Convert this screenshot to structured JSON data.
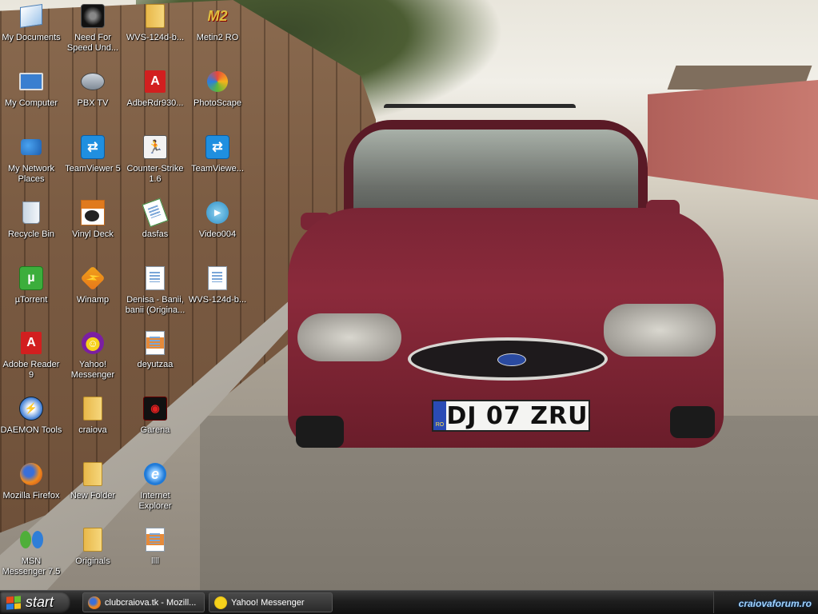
{
  "desktop": {
    "icons": [
      {
        "label": "My Documents",
        "icon": "my-documents-icon"
      },
      {
        "label": "My Computer",
        "icon": "my-computer-icon"
      },
      {
        "label": "My Network Places",
        "icon": "network-places-icon"
      },
      {
        "label": "Recycle Bin",
        "icon": "recycle-bin-icon"
      },
      {
        "label": "µTorrent",
        "icon": "utorrent-icon"
      },
      {
        "label": "Adobe Reader 9",
        "icon": "adobe-reader-icon"
      },
      {
        "label": "DAEMON Tools",
        "icon": "daemon-tools-icon"
      },
      {
        "label": "Mozilla Firefox",
        "icon": "firefox-icon"
      },
      {
        "label": "MSN Messenger 7.5",
        "icon": "msn-messenger-icon"
      },
      {
        "label": "Need For Speed Und...",
        "icon": "nfs-icon"
      },
      {
        "label": "PBX TV",
        "icon": "pbx-tv-icon"
      },
      {
        "label": "TeamViewer 5",
        "icon": "teamviewer-icon"
      },
      {
        "label": "Vinyl Deck",
        "icon": "vinyl-deck-icon"
      },
      {
        "label": "Winamp",
        "icon": "winamp-icon"
      },
      {
        "label": "Yahoo! Messenger",
        "icon": "yahoo-messenger-icon"
      },
      {
        "label": "craiova",
        "icon": "folder-icon"
      },
      {
        "label": "New Folder",
        "icon": "folder-icon"
      },
      {
        "label": "Originals",
        "icon": "folder-icon"
      },
      {
        "label": "WVS-124d-b...",
        "icon": "folder-icon"
      },
      {
        "label": "AdbeRdr930...",
        "icon": "pdf-installer-icon"
      },
      {
        "label": "Counter-Strike 1.6",
        "icon": "counter-strike-icon"
      },
      {
        "label": "dasfas",
        "icon": "document-icon"
      },
      {
        "label": "Denisa - Banii, banii (Origina...",
        "icon": "audio-file-icon"
      },
      {
        "label": "deyutzaa",
        "icon": "image-file-icon"
      },
      {
        "label": "Garena",
        "icon": "garena-icon"
      },
      {
        "label": "Internet Explorer",
        "icon": "internet-explorer-icon"
      },
      {
        "label": "llll",
        "icon": "image-file-icon"
      },
      {
        "label": "Metin2 RO",
        "icon": "metin2-icon"
      },
      {
        "label": "PhotoScape",
        "icon": "photoscape-icon"
      },
      {
        "label": "TeamViewe...",
        "icon": "teamviewer-icon"
      },
      {
        "label": "Video004",
        "icon": "video-file-icon"
      },
      {
        "label": "WVS-124d-b...",
        "icon": "document-icon"
      }
    ]
  },
  "wallpaper": {
    "plate_country": "RO",
    "plate_text": "DJ 07 ZRU"
  },
  "taskbar": {
    "start_label": "start",
    "tasks": [
      {
        "label": "clubcraiova.tk - Mozill...",
        "icon": "firefox-icon"
      },
      {
        "label": "Yahoo! Messenger",
        "icon": "yahoo-messenger-icon"
      }
    ],
    "watermark": "craiovaforum.ro"
  },
  "colors": {
    "taskbar": "#1e1e1e",
    "label_text": "#ffffff",
    "watermark": "#9fd3ff"
  }
}
